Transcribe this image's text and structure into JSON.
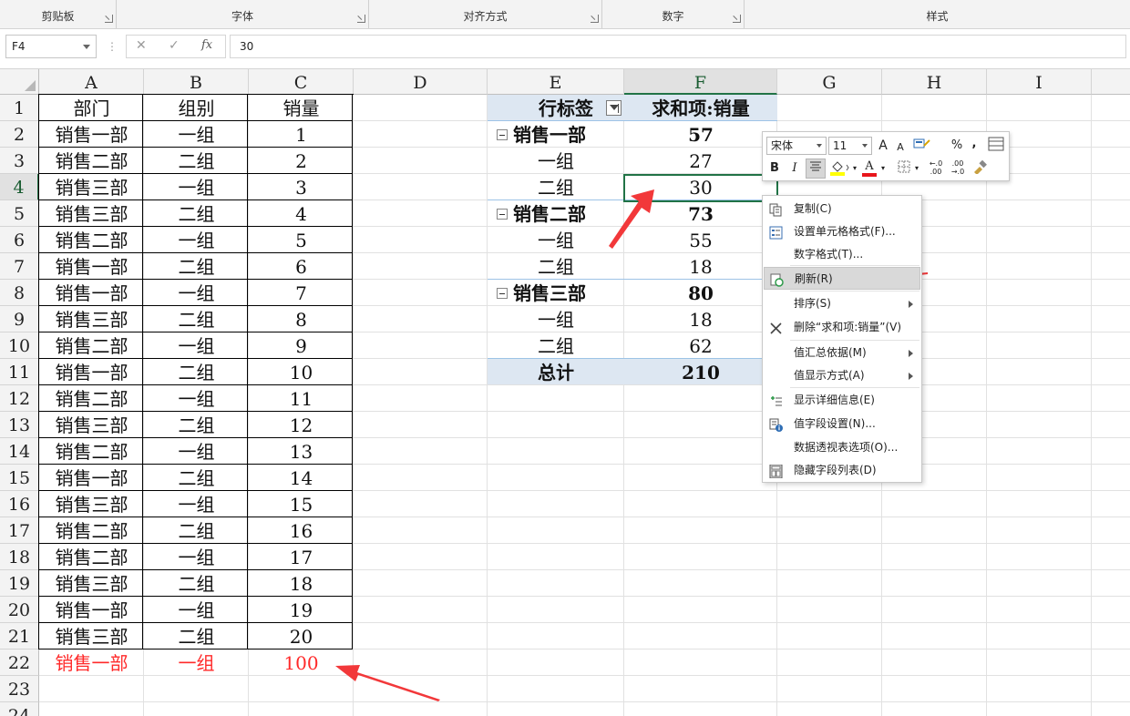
{
  "ribbon": {
    "groups": [
      {
        "label": "剪贴板",
        "launcher": true
      },
      {
        "label": "字体",
        "launcher": true
      },
      {
        "label": "对齐方式",
        "launcher": true
      },
      {
        "label": "数字",
        "launcher": true
      },
      {
        "label": "样式",
        "launcher": false
      }
    ]
  },
  "formula_bar": {
    "name_box": "F4",
    "cancel_glyph": "✕",
    "enter_glyph": "✓",
    "fx_glyph": "fx",
    "value": "30"
  },
  "columns": [
    "A",
    "B",
    "C",
    "D",
    "E",
    "F",
    "G",
    "H",
    "I"
  ],
  "selected_column": "F",
  "rows": [
    "1",
    "2",
    "3",
    "4",
    "5",
    "6",
    "7",
    "8",
    "9",
    "10",
    "11",
    "12",
    "13",
    "14",
    "15",
    "16",
    "17",
    "18",
    "19",
    "20",
    "21",
    "22",
    "23",
    "24"
  ],
  "selected_row": "4",
  "source_table": {
    "headers": [
      "部门",
      "组别",
      "销量"
    ],
    "rows": [
      [
        "销售一部",
        "一组",
        "1"
      ],
      [
        "销售二部",
        "二组",
        "2"
      ],
      [
        "销售三部",
        "一组",
        "3"
      ],
      [
        "销售三部",
        "二组",
        "4"
      ],
      [
        "销售二部",
        "一组",
        "5"
      ],
      [
        "销售一部",
        "二组",
        "6"
      ],
      [
        "销售一部",
        "一组",
        "7"
      ],
      [
        "销售三部",
        "二组",
        "8"
      ],
      [
        "销售二部",
        "一组",
        "9"
      ],
      [
        "销售一部",
        "二组",
        "10"
      ],
      [
        "销售二部",
        "一组",
        "11"
      ],
      [
        "销售三部",
        "二组",
        "12"
      ],
      [
        "销售二部",
        "一组",
        "13"
      ],
      [
        "销售一部",
        "二组",
        "14"
      ],
      [
        "销售三部",
        "一组",
        "15"
      ],
      [
        "销售二部",
        "二组",
        "16"
      ],
      [
        "销售二部",
        "一组",
        "17"
      ],
      [
        "销售三部",
        "二组",
        "18"
      ],
      [
        "销售一部",
        "一组",
        "19"
      ],
      [
        "销售三部",
        "二组",
        "20"
      ]
    ],
    "new_row": [
      "销售一部",
      "一组",
      "100"
    ],
    "new_row_color": "#ff2a2a"
  },
  "pivot": {
    "row_label_header": "行标签",
    "value_header": "求和项:销量",
    "groups": [
      {
        "name": "销售一部",
        "total": "57",
        "items": [
          {
            "name": "一组",
            "value": "27"
          },
          {
            "name": "二组",
            "value": "30"
          }
        ]
      },
      {
        "name": "销售二部",
        "total": "73",
        "items": [
          {
            "name": "一组",
            "value": "55"
          },
          {
            "name": "二组",
            "value": "18"
          }
        ]
      },
      {
        "name": "销售三部",
        "total": "80",
        "items": [
          {
            "name": "一组",
            "value": "18"
          },
          {
            "name": "二组",
            "value": "62"
          }
        ]
      }
    ],
    "grand_total_label": "总计",
    "grand_total": "210",
    "header_fill": "#dde7f2"
  },
  "mini_toolbar": {
    "font_name": "宋体",
    "font_size": "11",
    "grow_font": "A",
    "shrink_font": "A",
    "percent": "%",
    "comma": ",",
    "bold": "B",
    "italic": "I",
    "font_color_letter": "A",
    "increase_decimal": "←.0\n.00",
    "decrease_decimal": ".00\n→.0"
  },
  "context_menu": {
    "items": [
      {
        "label": "复制(C)",
        "icon": "copy-icon",
        "submenu": false
      },
      {
        "label": "设置单元格格式(F)...",
        "icon": "format-cells-icon",
        "submenu": false
      },
      {
        "label": "数字格式(T)...",
        "icon": "",
        "submenu": false
      },
      {
        "label": "刷新(R)",
        "icon": "refresh-icon",
        "submenu": false,
        "highlighted": true
      },
      {
        "label": "排序(S)",
        "icon": "",
        "submenu": true
      },
      {
        "label": "删除“求和项:销量”(V)",
        "icon": "delete-x-icon",
        "submenu": false
      },
      {
        "label": "值汇总依据(M)",
        "icon": "",
        "submenu": true
      },
      {
        "label": "值显示方式(A)",
        "icon": "",
        "submenu": true
      },
      {
        "label": "显示详细信息(E)",
        "icon": "show-detail-icon",
        "submenu": false
      },
      {
        "label": "值字段设置(N)...",
        "icon": "field-settings-icon",
        "submenu": false
      },
      {
        "label": "数据透视表选项(O)...",
        "icon": "",
        "submenu": false
      },
      {
        "label": "隐藏字段列表(D)",
        "icon": "field-list-icon",
        "submenu": false
      }
    ]
  },
  "colors": {
    "accent_green": "#217346",
    "annotation_red": "#f2383a"
  }
}
